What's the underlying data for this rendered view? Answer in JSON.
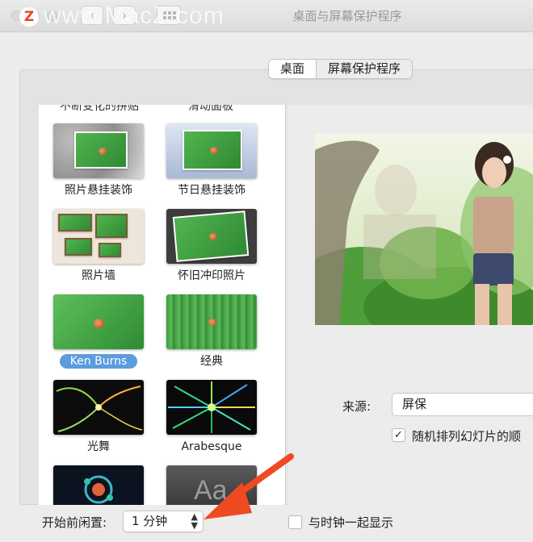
{
  "window": {
    "title": "桌面与屏幕保护程序"
  },
  "watermark": {
    "logo": "Z",
    "text": "www.MacZ.com"
  },
  "toolbar": {
    "back_glyph": "‹",
    "forward_glyph": "›"
  },
  "tabs": [
    {
      "label": "桌面",
      "active": true
    },
    {
      "label": "屏幕保护程序",
      "active": false
    }
  ],
  "screensavers": {
    "cut_off_labels": [
      "不断变化的拼贴",
      "滑动面板"
    ],
    "items": [
      {
        "label": "照片悬挂装饰",
        "icon": "photo-mobile-thumbnail",
        "selected": false
      },
      {
        "label": "节日悬挂装饰",
        "icon": "holiday-mobile-thumbnail",
        "selected": false
      },
      {
        "label": "照片墙",
        "icon": "photo-wall-thumbnail",
        "selected": false
      },
      {
        "label": "怀旧冲印照片",
        "icon": "vintage-prints-thumbnail",
        "selected": false
      },
      {
        "label": "Ken Burns",
        "icon": "ken-burns-thumbnail",
        "selected": true
      },
      {
        "label": "经典",
        "icon": "classic-thumbnail",
        "selected": false
      },
      {
        "label": "光舞",
        "icon": "flurry-thumbnail",
        "selected": false
      },
      {
        "label": "Arabesque",
        "icon": "arabesque-thumbnail",
        "selected": false
      },
      {
        "label": "",
        "icon": "shell-thumbnail",
        "selected": false
      },
      {
        "label": "",
        "icon": "message-thumbnail",
        "selected": false
      }
    ],
    "message_thumb_text": "Aa"
  },
  "options": {
    "source_label": "来源:",
    "source_value": "屏保",
    "shuffle_label": "随机排列幻灯片的顺",
    "shuffle_checked": true,
    "shuffle_check_glyph": "✓",
    "idle_label": "开始前闲置:",
    "idle_value": "1 分钟",
    "clock_label": "与时钟一起显示",
    "clock_checked": false
  },
  "colors": {
    "selection": "#5b9cde",
    "annotation_arrow": "#f04a23"
  }
}
